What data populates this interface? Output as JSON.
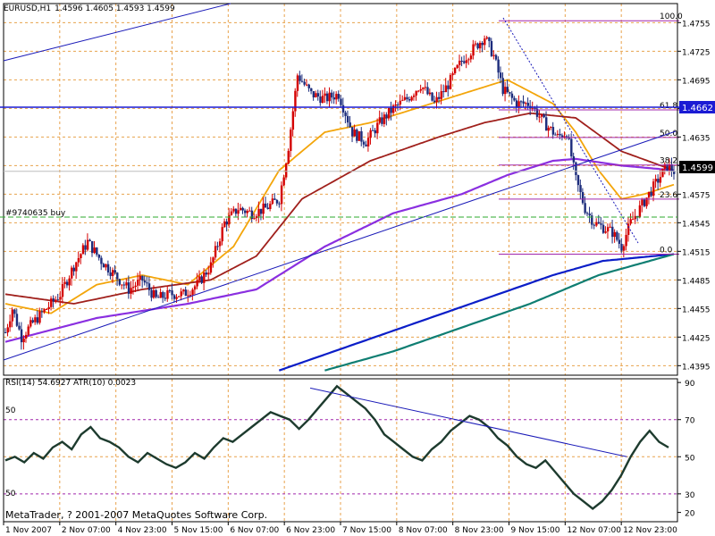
{
  "header": {
    "symbol_tf": "EURUSD,H1",
    "ohlc": "1.4596 1.4605 1.4593 1.4599"
  },
  "order_label": "#9740635 buy",
  "footer": {
    "copyright": "MetaTrader, ? 2001-2007 MetaQuotes Software Corp."
  },
  "indicator": {
    "title": "RSI(14) 54.6927  ATR(10) 0.0023"
  },
  "price_tags": {
    "hline": "1.4662",
    "current": "1.4599"
  },
  "fib_labels": [
    "100.0",
    "61.8",
    "50.0",
    "38.2",
    "23.6",
    "0.0"
  ],
  "rsi_level_labels": [
    "50",
    "50"
  ],
  "colors": {
    "bull": "#d40000",
    "bear": "#1c2c7c",
    "fast_ma": "#f3a50a",
    "mid_ma": "#a0201c",
    "slow_ma": "#8a2fe0",
    "ma200": "#0b1ec8",
    "ma_teal": "#0f7e72",
    "grid": "#e8a24d",
    "rsi_line": "#1d3b2e",
    "fib": "#a126ac",
    "hline": "#1b1bd4",
    "green_line": "#2ea82e"
  },
  "chart_data": [
    {
      "type": "candlestick",
      "title": "EURUSD,H1",
      "y_ticks": [
        "1.4755",
        "1.4725",
        "1.4695",
        "1.4665",
        "1.4635",
        "1.4605",
        "1.4575",
        "1.4545",
        "1.4515",
        "1.4485",
        "1.4455",
        "1.4425",
        "1.4395"
      ],
      "x_ticks": [
        "1 Nov 2007",
        "2 Nov 07:00",
        "4 Nov 23:00",
        "5 Nov 15:00",
        "6 Nov 07:00",
        "6 Nov 23:00",
        "7 Nov 15:00",
        "8 Nov 07:00",
        "8 Nov 23:00",
        "9 Nov 15:00",
        "12 Nov 07:00",
        "12 Nov 23:00"
      ],
      "ylim": [
        1.4385,
        1.4775
      ],
      "horizontal_line": 1.4662,
      "current_price": 1.4599,
      "fibonacci": {
        "levels": [
          "100.0",
          "61.8",
          "50.0",
          "38.2",
          "23.6",
          "0.0"
        ],
        "high": 1.4757,
        "low": 1.4512
      },
      "close_waypoints": [
        [
          0,
          1.443
        ],
        [
          3,
          1.4455
        ],
        [
          7,
          1.4425
        ],
        [
          12,
          1.444
        ],
        [
          18,
          1.4455
        ],
        [
          24,
          1.447
        ],
        [
          30,
          1.45
        ],
        [
          36,
          1.4525
        ],
        [
          42,
          1.4505
        ],
        [
          48,
          1.449
        ],
        [
          54,
          1.4475
        ],
        [
          60,
          1.4485
        ],
        [
          66,
          1.4465
        ],
        [
          72,
          1.447
        ],
        [
          78,
          1.447
        ],
        [
          84,
          1.448
        ],
        [
          90,
          1.45
        ],
        [
          96,
          1.4545
        ],
        [
          102,
          1.456
        ],
        [
          108,
          1.4555
        ],
        [
          114,
          1.456
        ],
        [
          120,
          1.457
        ],
        [
          124,
          1.4625
        ],
        [
          128,
          1.47
        ],
        [
          134,
          1.468
        ],
        [
          140,
          1.4675
        ],
        [
          146,
          1.468
        ],
        [
          152,
          1.464
        ],
        [
          158,
          1.463
        ],
        [
          164,
          1.465
        ],
        [
          170,
          1.4665
        ],
        [
          176,
          1.4675
        ],
        [
          182,
          1.469
        ],
        [
          188,
          1.467
        ],
        [
          194,
          1.469
        ],
        [
          200,
          1.4715
        ],
        [
          206,
          1.473
        ],
        [
          210,
          1.474
        ],
        [
          214,
          1.472
        ],
        [
          218,
          1.4685
        ],
        [
          224,
          1.467
        ],
        [
          230,
          1.467
        ],
        [
          236,
          1.465
        ],
        [
          242,
          1.4635
        ],
        [
          246,
          1.464
        ],
        [
          250,
          1.459
        ],
        [
          254,
          1.456
        ],
        [
          258,
          1.4545
        ],
        [
          262,
          1.454
        ],
        [
          266,
          1.4535
        ],
        [
          270,
          1.452
        ],
        [
          274,
          1.4545
        ],
        [
          278,
          1.456
        ],
        [
          282,
          1.4575
        ],
        [
          286,
          1.459
        ],
        [
          290,
          1.4605
        ],
        [
          293,
          1.4599
        ]
      ],
      "series": [
        {
          "name": "fast",
          "waypoints": [
            [
              0,
              1.446
            ],
            [
              20,
              1.445
            ],
            [
              40,
              1.448
            ],
            [
              60,
              1.449
            ],
            [
              80,
              1.448
            ],
            [
              100,
              1.452
            ],
            [
              120,
              1.46
            ],
            [
              140,
              1.464
            ],
            [
              160,
              1.465
            ],
            [
              180,
              1.4665
            ],
            [
              200,
              1.468
            ],
            [
              220,
              1.4695
            ],
            [
              240,
              1.467
            ],
            [
              250,
              1.464
            ],
            [
              260,
              1.46
            ],
            [
              270,
              1.457
            ],
            [
              280,
              1.4575
            ],
            [
              293,
              1.4585
            ]
          ]
        },
        {
          "name": "mid",
          "waypoints": [
            [
              0,
              1.447
            ],
            [
              30,
              1.446
            ],
            [
              60,
              1.4475
            ],
            [
              90,
              1.4485
            ],
            [
              110,
              1.451
            ],
            [
              130,
              1.457
            ],
            [
              160,
              1.461
            ],
            [
              190,
              1.4635
            ],
            [
              210,
              1.465
            ],
            [
              230,
              1.466
            ],
            [
              250,
              1.4655
            ],
            [
              270,
              1.462
            ],
            [
              293,
              1.46
            ]
          ]
        },
        {
          "name": "slow",
          "waypoints": [
            [
              0,
              1.442
            ],
            [
              40,
              1.4445
            ],
            [
              80,
              1.446
            ],
            [
              110,
              1.4475
            ],
            [
              140,
              1.452
            ],
            [
              170,
              1.4555
            ],
            [
              200,
              1.4575
            ],
            [
              220,
              1.4595
            ],
            [
              240,
              1.461
            ],
            [
              250,
              1.4612
            ],
            [
              270,
              1.4605
            ],
            [
              293,
              1.46
            ]
          ]
        },
        {
          "name": "ma200",
          "waypoints": [
            [
              120,
              1.439
            ],
            [
              150,
              1.4415
            ],
            [
              180,
              1.444
            ],
            [
              210,
              1.4465
            ],
            [
              240,
              1.449
            ],
            [
              262,
              1.4505
            ],
            [
              293,
              1.4512
            ]
          ]
        },
        {
          "name": "teal",
          "waypoints": [
            [
              140,
              1.439
            ],
            [
              170,
              1.441
            ],
            [
              200,
              1.4435
            ],
            [
              230,
              1.446
            ],
            [
              260,
              1.449
            ],
            [
              293,
              1.4512
            ]
          ]
        }
      ]
    },
    {
      "type": "line",
      "title": "RSI(14) 54.6927  ATR(10) 0.0023",
      "y_ticks": [
        "90",
        "70",
        "50",
        "30",
        "20"
      ],
      "ylim": [
        15,
        92
      ],
      "values": [
        48,
        50,
        47,
        52,
        49,
        55,
        58,
        54,
        62,
        66,
        60,
        58,
        55,
        50,
        47,
        52,
        49,
        46,
        44,
        47,
        52,
        49,
        55,
        60,
        58,
        62,
        66,
        70,
        74,
        72,
        70,
        65,
        70,
        76,
        82,
        88,
        84,
        80,
        76,
        70,
        62,
        58,
        54,
        50,
        48,
        54,
        58,
        64,
        68,
        72,
        70,
        66,
        60,
        56,
        50,
        46,
        44,
        48,
        42,
        36,
        30,
        26,
        22,
        26,
        32,
        40,
        50,
        58,
        64,
        58,
        55
      ],
      "trendline": [
        [
          0.455,
          87
        ],
        [
          0.925,
          50
        ]
      ]
    }
  ]
}
